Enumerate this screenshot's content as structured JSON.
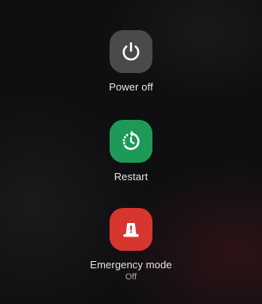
{
  "power_menu": {
    "power_off": {
      "label": "Power off",
      "icon": "power-icon",
      "color": "#4a4a4c"
    },
    "restart": {
      "label": "Restart",
      "icon": "restart-icon",
      "color": "#1e9a58"
    },
    "emergency": {
      "label": "Emergency mode",
      "status": "Off",
      "icon": "emergency-siren-icon",
      "color": "#d6362e"
    }
  }
}
